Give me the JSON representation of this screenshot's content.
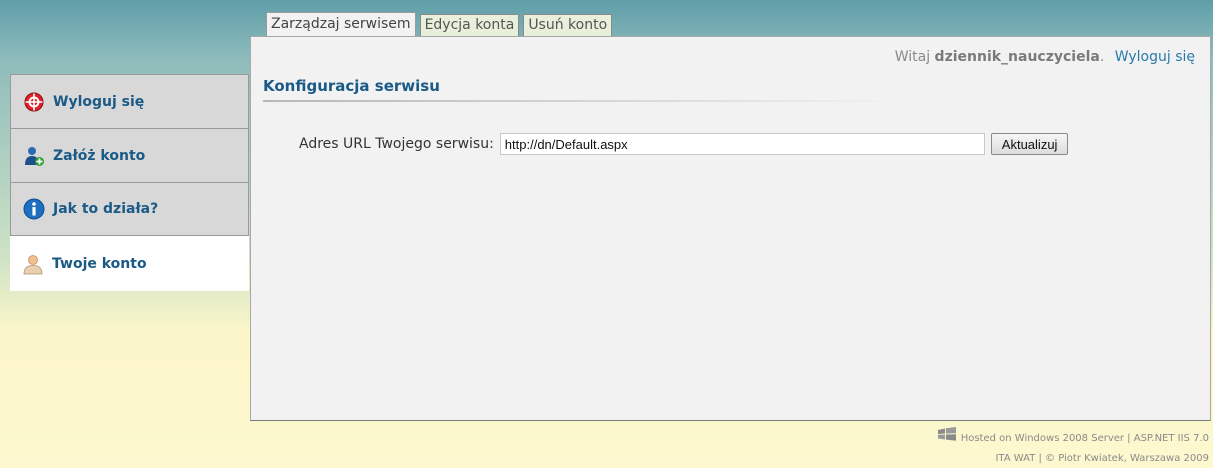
{
  "tabs": [
    {
      "label": "Zarządzaj serwisem",
      "active": true
    },
    {
      "label": "Edycja konta",
      "active": false
    },
    {
      "label": "Usuń konto",
      "active": false
    }
  ],
  "header": {
    "greeting": "Witaj",
    "username": "dziennik_nauczyciela",
    "period": ".",
    "logout_link": "Wyloguj się"
  },
  "section": {
    "title": "Konfiguracja serwisu"
  },
  "form": {
    "url_label": "Adres URL Twojego serwisu:",
    "url_value": "http://dn/Default.aspx",
    "update_button": "Aktualizuj"
  },
  "menu": {
    "items": [
      {
        "label": "Wyloguj się",
        "icon": "logout-icon"
      },
      {
        "label": "Załóż konto",
        "icon": "add-user-icon"
      },
      {
        "label": "Jak to działa?",
        "icon": "info-icon"
      },
      {
        "label": "Twoje konto",
        "icon": "user-icon",
        "active": true
      }
    ]
  },
  "footer": {
    "hosted": "Hosted on Windows 2008 Server | ASP.NET IIS 7.0",
    "credits": "ITA WAT | © Piotr Kwiatek, Warszawa 2009"
  },
  "colors": {
    "accent": "#1a5a86",
    "link": "#2a7aa8",
    "panel": "#f2f2f2"
  }
}
